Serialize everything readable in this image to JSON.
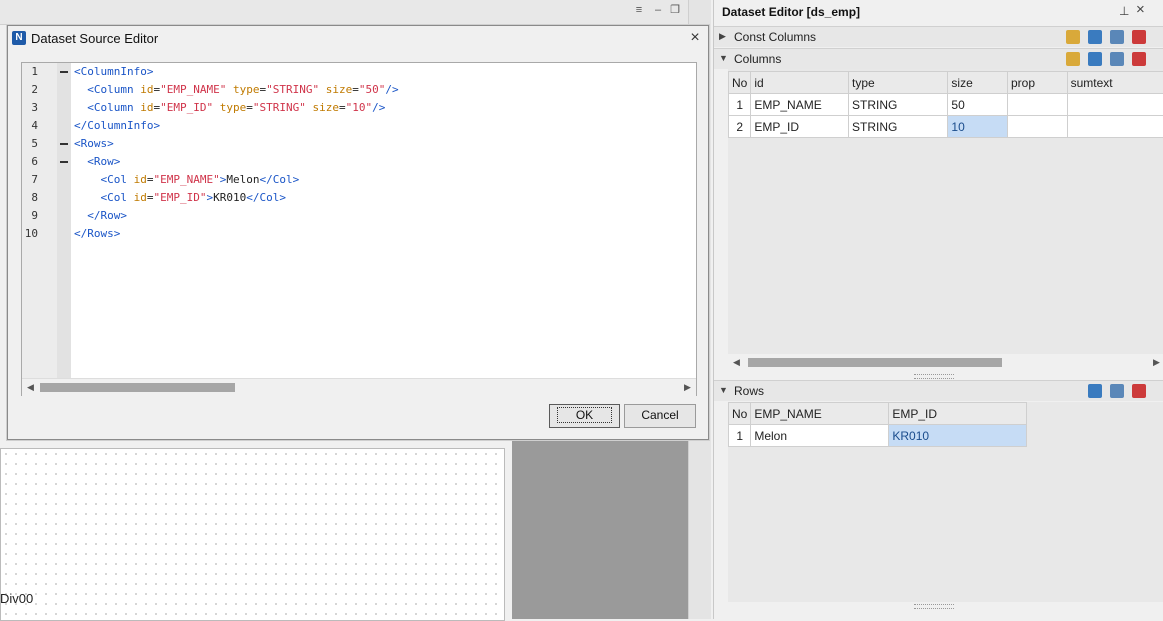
{
  "background": {
    "design_label": "Div00"
  },
  "dialog": {
    "title": "Dataset Source Editor",
    "close_symbol": "×",
    "line_numbers": [
      "1",
      "2",
      "3",
      "4",
      "5",
      "6",
      "7",
      "8",
      "9",
      "10"
    ],
    "code": {
      "l1_tag": "<ColumnInfo>",
      "l2_open": "<Column",
      "l2_attr1": "id",
      "l2_val1": "\"EMP_NAME\"",
      "l2_attr2": "type",
      "l2_val2": "\"STRING\"",
      "l2_attr3": "size",
      "l2_val3": "\"50\"",
      "l2_close": "/>",
      "l3_open": "<Column",
      "l3_attr1": "id",
      "l3_val1": "\"EMP_ID\"",
      "l3_attr2": "type",
      "l3_val2": "\"STRING\"",
      "l3_attr3": "size",
      "l3_val3": "\"10\"",
      "l3_close": "/>",
      "l4_tag": "</ColumnInfo>",
      "l5_tag": "<Rows>",
      "l6_tag": "<Row>",
      "l7_open": "<Col",
      "l7_attr": "id",
      "l7_val": "\"EMP_NAME\"",
      "l7_gt": ">",
      "l7_text": "Melon",
      "l7_close": "</Col>",
      "l8_open": "<Col",
      "l8_attr": "id",
      "l8_val": "\"EMP_ID\"",
      "l8_gt": ">",
      "l8_text": "KR010",
      "l8_close": "</Col>",
      "l9_tag": "</Row>",
      "l10_tag": "</Rows>"
    },
    "ok_label": "OK",
    "cancel_label": "Cancel"
  },
  "panel": {
    "title": "Dataset Editor [ds_emp]",
    "pin_symbol": "⊥",
    "close_symbol": "×",
    "const_columns_label": "Const Columns",
    "columns_label": "Columns",
    "rows_label": "Rows",
    "columns_table": {
      "headers": [
        "No",
        "id",
        "type",
        "size",
        "prop",
        "sumtext"
      ],
      "rows": [
        [
          "1",
          "EMP_NAME",
          "STRING",
          "50",
          "",
          ""
        ],
        [
          "2",
          "EMP_ID",
          "STRING",
          "10",
          "",
          ""
        ]
      ]
    },
    "rows_table": {
      "headers": [
        "No",
        "EMP_NAME",
        "EMP_ID"
      ],
      "rows": [
        [
          "1",
          "Melon",
          "KR010"
        ]
      ]
    }
  },
  "colors": {
    "selection": "#c6dcf5",
    "tag": "#1a55c7",
    "attribute": "#c07a00",
    "value": "#d0344a"
  },
  "icons": [
    "menu-icon",
    "minimize-icon",
    "restore-icon",
    "close-icon",
    "app-icon",
    "pin-icon",
    "add-column-icon",
    "add-row-icon",
    "delete-icon",
    "chevron-right-icon",
    "chevron-down-icon"
  ]
}
